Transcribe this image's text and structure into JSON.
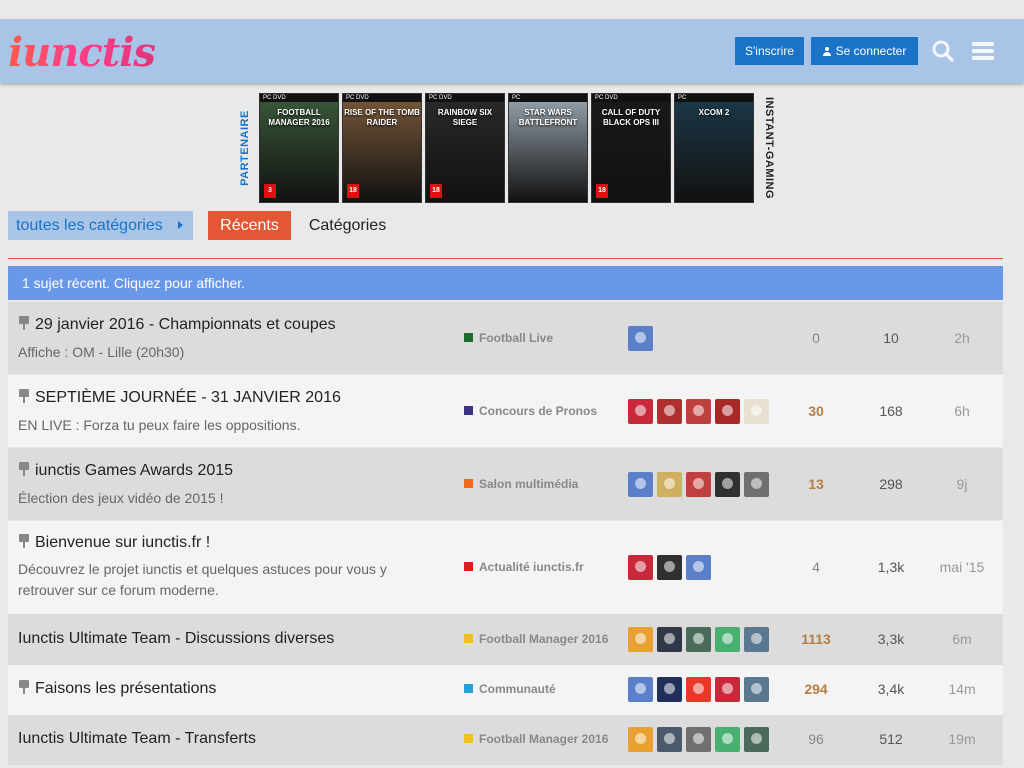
{
  "header": {
    "logo": "iunctis",
    "signup_label": "S'inscrire",
    "login_label": "Se connecter",
    "search_icon": "search-icon",
    "menu_icon": "hamburger-menu-icon"
  },
  "banner": {
    "left_label": "PARTENAIRE",
    "right_label": "INSTANT-GAMING",
    "games": [
      {
        "title": "FOOTBALL MANAGER 2016",
        "platform": "PC DVD",
        "rating": "3",
        "color": "#3a5a3a"
      },
      {
        "title": "RISE OF THE TOMB RAIDER",
        "platform": "PC DVD",
        "rating": "18",
        "color": "#7a5a3a"
      },
      {
        "title": "RAINBOW SIX SIEGE",
        "platform": "PC DVD",
        "rating": "18",
        "color": "#2a2a2a"
      },
      {
        "title": "STAR WARS BATTLEFRONT",
        "platform": "PC",
        "rating": "",
        "color": "#9aa6b0"
      },
      {
        "title": "CALL OF DUTY BLACK OPS III",
        "platform": "PC DVD",
        "rating": "18",
        "color": "#1a1a1a"
      },
      {
        "title": "XCOM 2",
        "platform": "PC",
        "rating": "",
        "color": "#1c3a4a"
      }
    ]
  },
  "nav": {
    "category_dropdown": "toutes les catégories",
    "tab_recent": "Récents",
    "tab_categories": "Catégories"
  },
  "alert": {
    "text": "1 sujet récent. Cliquez pour afficher."
  },
  "topics": [
    {
      "title": "29 janvier 2016 - Championnats et coupes",
      "pinned": true,
      "excerpt": "Affiche : OM - Lille (20h30)",
      "category": "Football Live",
      "category_color": "#1e6b2e",
      "posters": [
        "#5b7fc9"
      ],
      "replies": "0",
      "replies_hot": false,
      "views": "10",
      "activity": "2h"
    },
    {
      "title": "SEPTIÈME JOURNÉE - 31 JANVIER 2016",
      "pinned": true,
      "excerpt": "EN LIVE : Forza tu peux faire les oppositions.",
      "category": "Concours de Pronos",
      "category_color": "#3a3580",
      "posters": [
        "#c8283a",
        "#b03030",
        "#c04040",
        "#a82828",
        "#e8e0d0"
      ],
      "replies": "30",
      "replies_hot": true,
      "views": "168",
      "activity": "6h"
    },
    {
      "title": "iunctis Games Awards 2015",
      "pinned": true,
      "excerpt": "Élection des jeux vidéo de 2015 !",
      "category": "Salon multimédia",
      "category_color": "#f06a1c",
      "posters": [
        "#5b7fc9",
        "#d0b060",
        "#c04040",
        "#303030",
        "#707070"
      ],
      "replies": "13",
      "replies_hot": true,
      "views": "298",
      "activity": "9j"
    },
    {
      "title": "Bienvenue sur iunctis.fr !",
      "pinned": true,
      "excerpt": "Découvrez le projet iunctis et quelques astuces pour vous y retrouver sur ce forum moderne.",
      "category": "Actualité iunctis.fr",
      "category_color": "#e21c1c",
      "posters": [
        "#c8283a",
        "#303030",
        "#5b7fc9"
      ],
      "replies": "4",
      "replies_hot": false,
      "views": "1,3k",
      "activity": "mai '15"
    },
    {
      "title": "Iunctis Ultimate Team - Discussions diverses",
      "pinned": false,
      "excerpt": "",
      "category": "Football Manager 2016",
      "category_color": "#f0c020",
      "posters": [
        "#e8a030",
        "#303848",
        "#4a6a5a",
        "#48b070",
        "#5a7890"
      ],
      "replies": "1113",
      "replies_hot": true,
      "views": "3,3k",
      "activity": "6m"
    },
    {
      "title": "Faisons les présentations",
      "pinned": true,
      "excerpt": "",
      "category": "Communauté",
      "category_color": "#2aa0d8",
      "posters": [
        "#5b7fc9",
        "#20305a",
        "#e83828",
        "#c8283a",
        "#5a7890"
      ],
      "replies": "294",
      "replies_hot": true,
      "views": "3,4k",
      "activity": "14m"
    },
    {
      "title": "Iunctis Ultimate Team - Transferts",
      "pinned": false,
      "excerpt": "",
      "category": "Football Manager 2016",
      "category_color": "#f0c020",
      "posters": [
        "#e8a030",
        "#4a5a6a",
        "#707070",
        "#48b070",
        "#4a6a5a"
      ],
      "replies": "96",
      "replies_hot": false,
      "views": "512",
      "activity": "19m"
    }
  ]
}
